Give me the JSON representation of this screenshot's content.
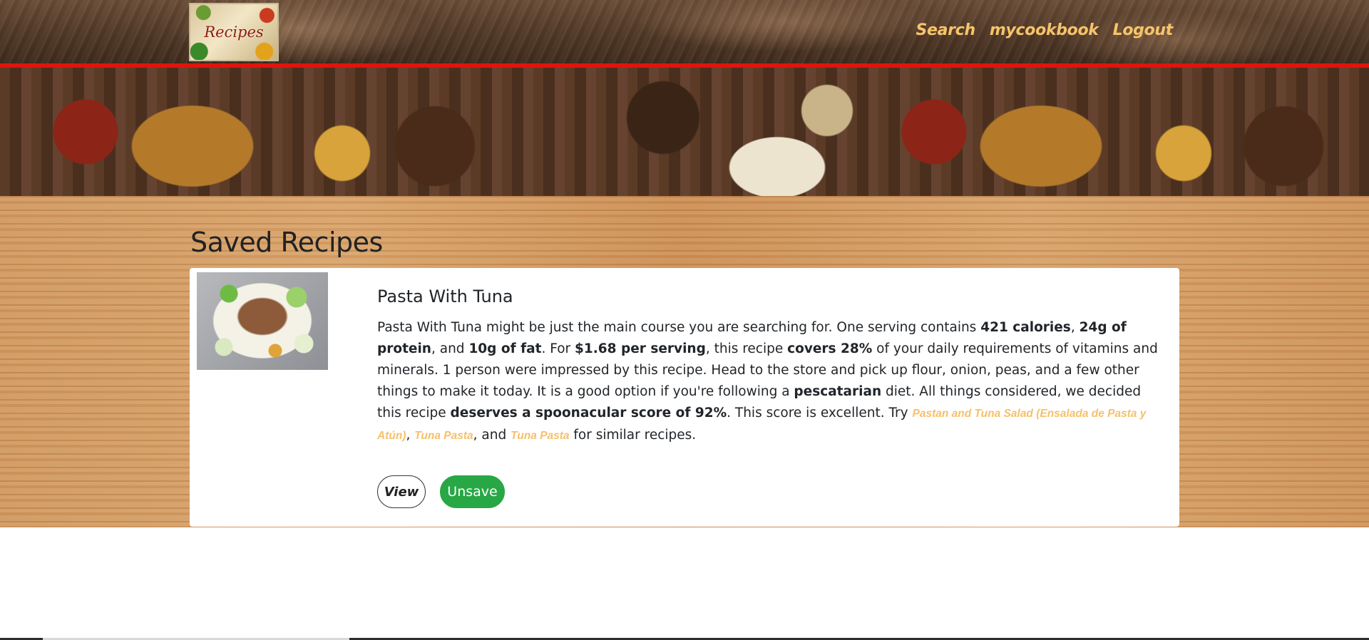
{
  "navbar": {
    "brand_text": "Recipes",
    "links": [
      {
        "label": "Search"
      },
      {
        "label": "mycookbook"
      },
      {
        "label": "Logout"
      }
    ]
  },
  "page": {
    "title": "Saved Recipes"
  },
  "recipes": [
    {
      "title": "Pasta With Tuna",
      "summary": {
        "s1": "Pasta With Tuna might be just the main course you are searching for. One serving contains ",
        "b1": "421 calories",
        "s2": ", ",
        "b2": "24g of protein",
        "s3": ", and ",
        "b3": "10g of fat",
        "s4": ". For ",
        "b4": "$1.68 per serving",
        "s5": ", this recipe ",
        "b5": "covers 28%",
        "s6": " of your daily requirements of vitamins and minerals. 1 person were impressed by this recipe. Head to the store and pick up flour, onion, peas, and a few other things to make it today. It is a good option if you're following a ",
        "b6": "pescatarian",
        "s7": " diet. All things considered, we decided this recipe ",
        "b7": "deserves a spoonacular score of 92%",
        "s8": ". This score is excellent. Try ",
        "link1": "Pastan and Tuna Salad (Ensalada de Pasta y Atún)",
        "s9": ", ",
        "link2": "Tuna Pasta",
        "s10": ", and ",
        "link3": "Tuna Pasta",
        "s11": " for similar recipes."
      },
      "view_label": "View",
      "unsave_label": "Unsave"
    }
  ],
  "colors": {
    "nav_link": "#f6c46a",
    "nav_border": "#e0140c",
    "recipe_link": "#f6c06a",
    "unsave_button": "#28a745"
  }
}
